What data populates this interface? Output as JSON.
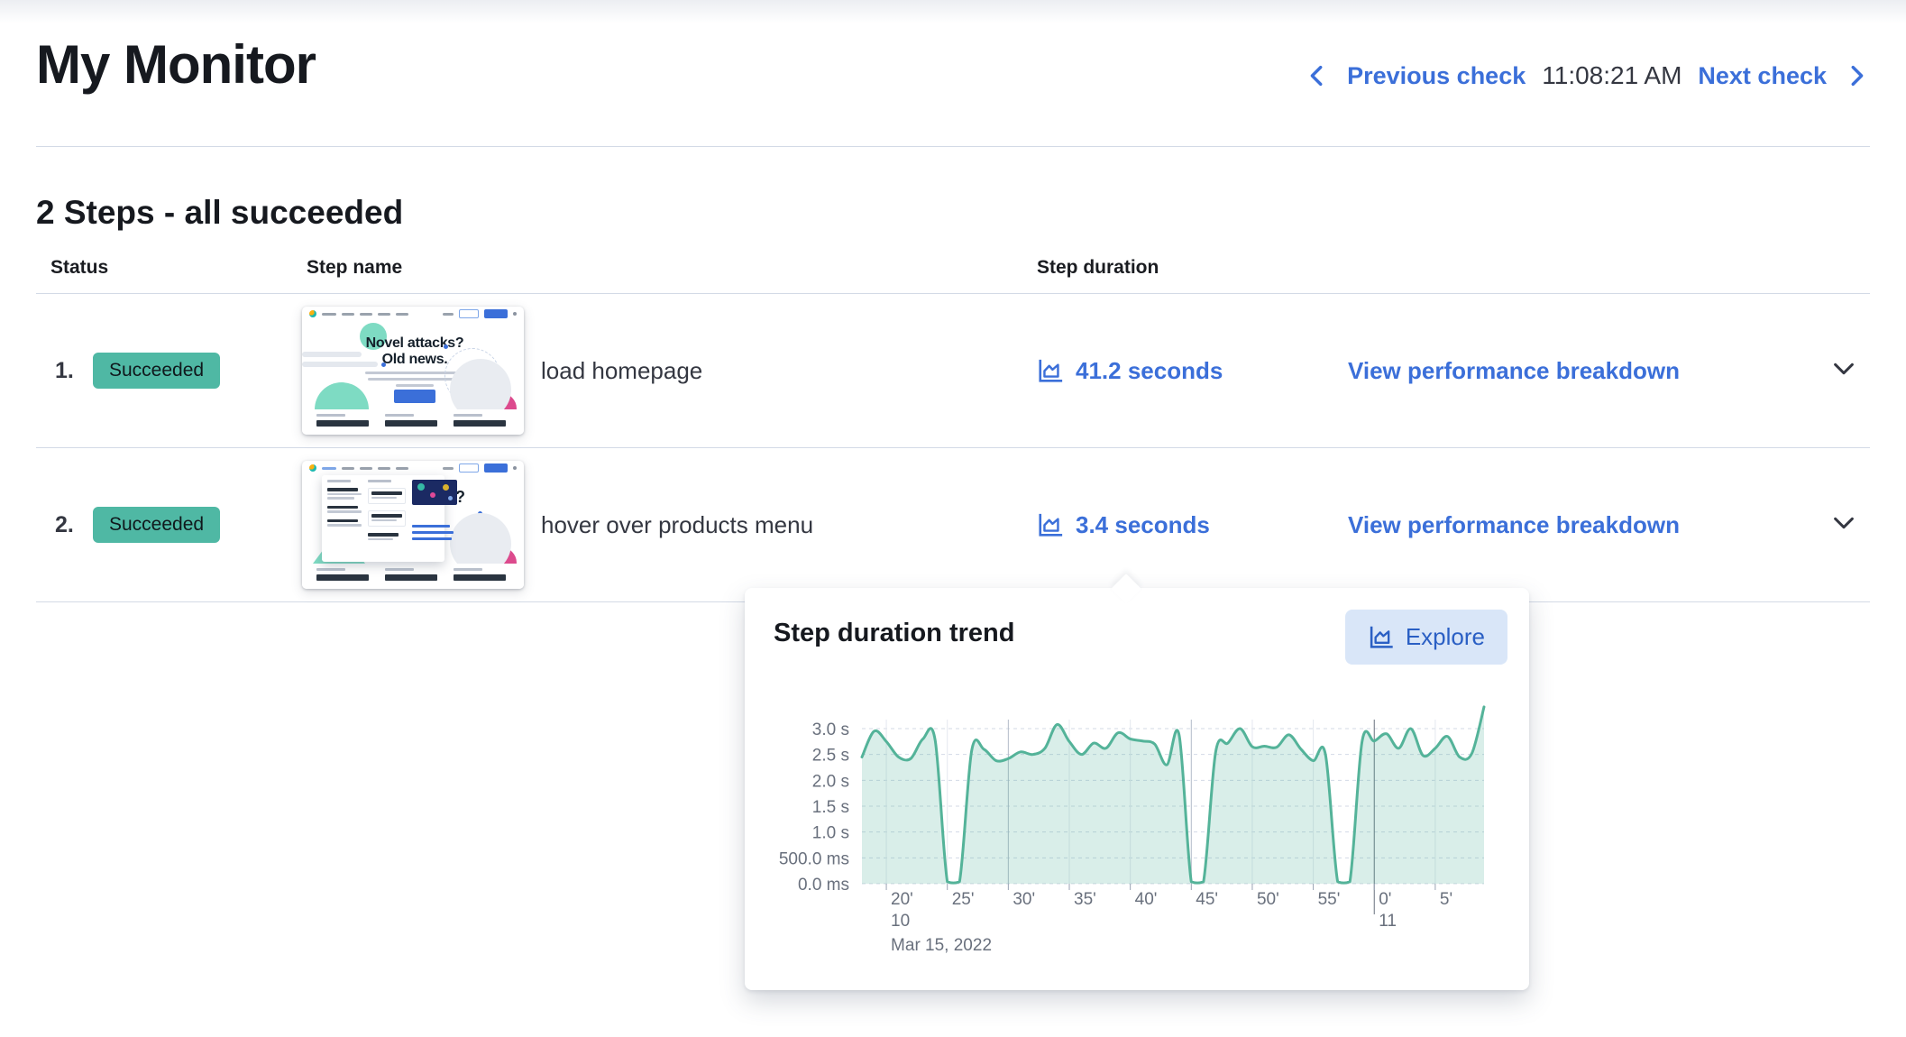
{
  "header": {
    "title": "My Monitor",
    "previous_label": "Previous check",
    "time": "11:08:21 AM",
    "next_label": "Next check"
  },
  "steps_section": {
    "heading": "2 Steps - all succeeded",
    "columns": {
      "status": "Status",
      "name": "Step name",
      "duration": "Step duration"
    },
    "rows": [
      {
        "number": "1.",
        "status": "Succeeded",
        "name": "load homepage",
        "duration": "41.2 seconds",
        "view_label": "View performance breakdown"
      },
      {
        "number": "2.",
        "status": "Succeeded",
        "name": "hover over products menu",
        "duration": "3.4 seconds",
        "view_label": "View performance breakdown"
      }
    ]
  },
  "thumbnail": {
    "headline_line1": "Novel attacks?",
    "headline_line2": "Old news.",
    "headline_fragment": "s?"
  },
  "popover": {
    "title": "Step duration trend",
    "explore_label": "Explore"
  },
  "colors": {
    "link_blue": "#3b6fd9",
    "badge_teal": "#4FB8A4",
    "chart_line": "#54B399",
    "chart_fill": "rgba(84,179,153,0.22)",
    "axis_text": "#69707D",
    "divider": "#D3DAE6"
  },
  "chart_data": {
    "type": "area",
    "title": "Step duration trend",
    "ylabel": "step duration",
    "ylim_seconds": [
      0,
      3.5
    ],
    "y_ticks_seconds": [
      0,
      0.5,
      1,
      1.5,
      2,
      2.5,
      3
    ],
    "y_tick_labels": [
      "0.0 ms",
      "500.0 ms",
      "1.0 s",
      "1.5 s",
      "2.0 s",
      "2.5 s",
      "3.0 s"
    ],
    "x_start_minute": 18,
    "x_tick_minutes": [
      20,
      25,
      30,
      35,
      40,
      45,
      50,
      55,
      60,
      65
    ],
    "x_tick_labels": [
      "20'",
      "25'",
      "30'",
      "35'",
      "40'",
      "45'",
      "50'",
      "55'",
      "0'",
      "5'"
    ],
    "major_tick_minutes": [
      30,
      45
    ],
    "hour_line_minute": 60,
    "hour_markers": [
      {
        "minute": 20,
        "label": "10"
      },
      {
        "minute": 60,
        "label": "11"
      }
    ],
    "date_label": "Mar 15, 2022",
    "values_seconds": [
      2.45,
      2.95,
      2.75,
      2.45,
      2.42,
      2.8,
      2.78,
      0.04,
      0.04,
      2.58,
      2.6,
      2.38,
      2.42,
      2.55,
      2.5,
      2.62,
      3.08,
      2.75,
      2.5,
      2.72,
      2.62,
      2.92,
      2.8,
      2.76,
      2.7,
      2.3,
      2.88,
      0.04,
      0.04,
      2.55,
      2.72,
      3.0,
      2.65,
      2.66,
      2.64,
      2.88,
      2.6,
      2.38,
      2.5,
      0.04,
      0.04,
      2.75,
      2.76,
      2.9,
      2.62,
      3.0,
      2.48,
      2.62,
      2.85,
      2.45,
      2.52,
      3.42
    ],
    "grid": "on",
    "legend": "none"
  }
}
